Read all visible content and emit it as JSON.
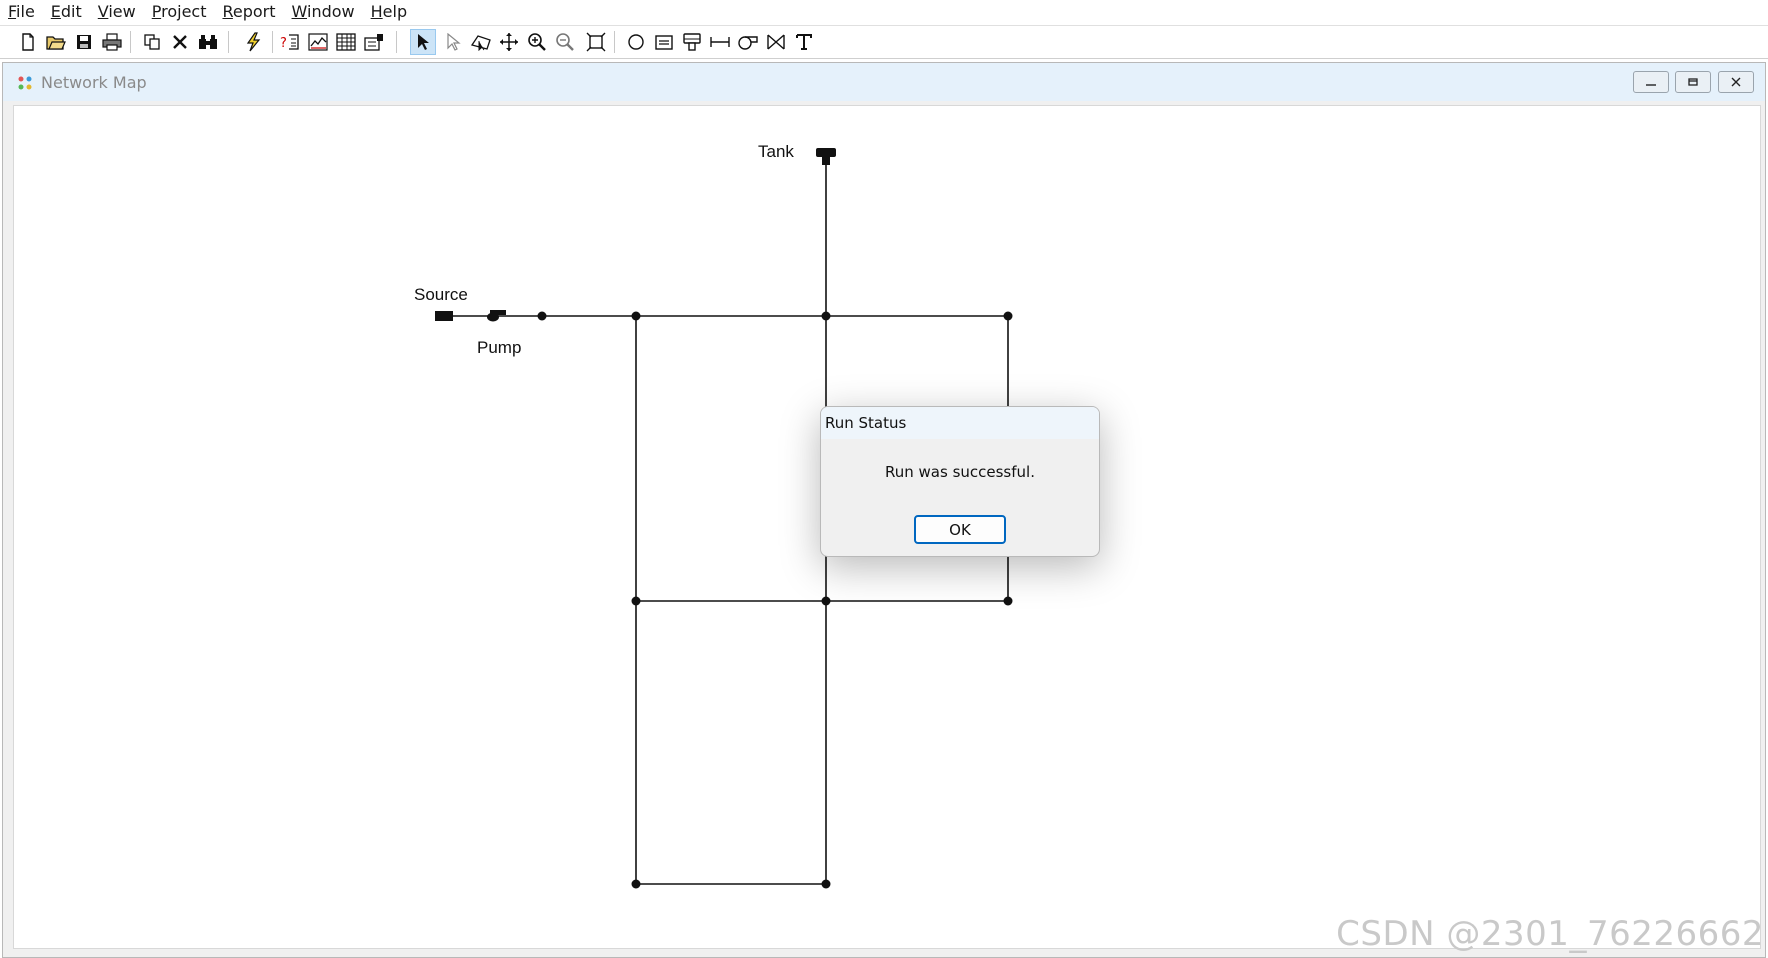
{
  "menu": {
    "items": [
      {
        "mnemonic": "F",
        "rest": "ile"
      },
      {
        "mnemonic": "E",
        "rest": "dit"
      },
      {
        "mnemonic": "V",
        "rest": "iew"
      },
      {
        "mnemonic": "P",
        "rest": "roject"
      },
      {
        "mnemonic": "R",
        "rest": "eport"
      },
      {
        "mnemonic": "W",
        "rest": "indow"
      },
      {
        "mnemonic": "H",
        "rest": "elp"
      }
    ]
  },
  "toolbar": {
    "icons": [
      "new-file-icon",
      "open-folder-icon",
      "save-icon",
      "print-icon",
      "copy-icon",
      "delete-icon",
      "find-icon",
      "run-icon",
      "query-icon",
      "graph-icon",
      "table-icon",
      "options-icon",
      "select-object-icon",
      "select-vertex-icon",
      "select-region-icon",
      "pan-icon",
      "zoom-in-icon",
      "zoom-out-icon",
      "full-extent-icon",
      "add-junction-icon",
      "add-reservoir-icon",
      "add-tank-icon",
      "add-pipe-icon",
      "add-pump-icon",
      "add-valve-icon",
      "add-label-icon"
    ],
    "active": "select-object-icon"
  },
  "window": {
    "title": "Network Map"
  },
  "map": {
    "labels": {
      "tank": "Tank",
      "source": "Source",
      "pump": "Pump"
    }
  },
  "dialog": {
    "title": "Run Status",
    "message": "Run was successful.",
    "ok_label": "OK"
  },
  "watermark": "CSDN @2301_76226662"
}
